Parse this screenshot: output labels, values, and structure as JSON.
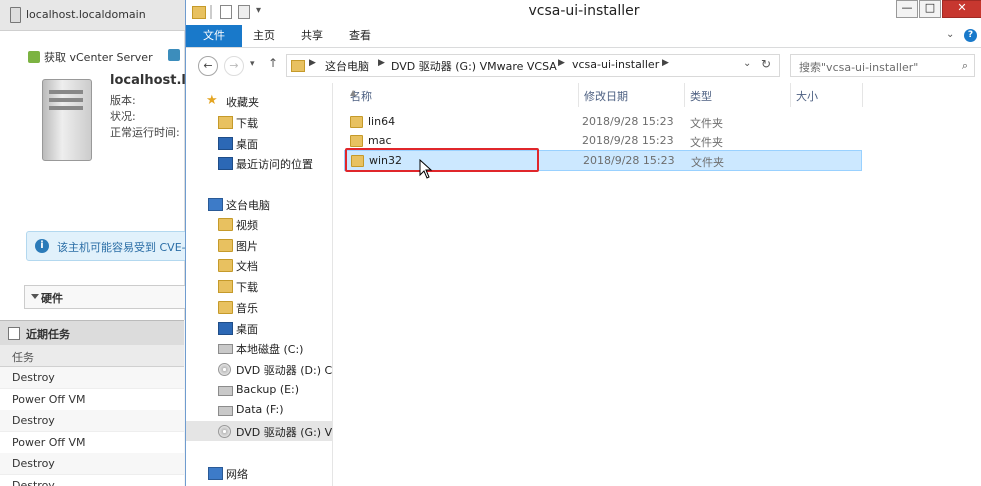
{
  "background_app": {
    "host_tab": "localhost.localdomain",
    "action_label": "获取 vCenter Server",
    "hostname": "localhost.lo",
    "fields": [
      "版本:",
      "状况:",
      "正常运行时间:"
    ],
    "alert_text": "该主机可能容易受到 CVE-",
    "hardware_label": "硬件",
    "recent_tasks_title": "近期任务",
    "tasks_column": "任务",
    "tasks": [
      "Destroy",
      "Power Off VM",
      "Destroy",
      "Power Off VM",
      "Destroy",
      "Destroy"
    ]
  },
  "window": {
    "title": "vcsa-ui-installer",
    "min_glyph": "—",
    "max_glyph": "□",
    "close_glyph": "✕",
    "help_glyph": "?"
  },
  "ribbon": {
    "tabs": [
      "文件",
      "主页",
      "共享",
      "查看"
    ]
  },
  "address": {
    "crumbs": [
      "这台电脑",
      "DVD 驱动器 (G:) VMware VCSA",
      "vcsa-ui-installer"
    ],
    "search_placeholder": "搜索\"vcsa-ui-installer\""
  },
  "nav": {
    "favorites": "收藏夹",
    "favorite_items": [
      "下载",
      "桌面",
      "最近访问的位置"
    ],
    "this_pc": "这台电脑",
    "pc_items": [
      "视频",
      "图片",
      "文档",
      "下载",
      "音乐",
      "桌面",
      "本地磁盘 (C:)",
      "DVD 驱动器 (D:) CD",
      "Backup (E:)",
      "Data (F:)",
      "DVD 驱动器 (G:) VM"
    ],
    "network": "网络"
  },
  "columns": {
    "name": "名称",
    "date": "修改日期",
    "type": "类型",
    "size": "大小"
  },
  "files": [
    {
      "name": "lin64",
      "date": "2018/9/28 15:23",
      "type": "文件夹"
    },
    {
      "name": "mac",
      "date": "2018/9/28 15:23",
      "type": "文件夹"
    },
    {
      "name": "win32",
      "date": "2018/9/28 15:23",
      "type": "文件夹"
    }
  ],
  "colors": {
    "accent": "#1979ca",
    "selection": "#cce8ff",
    "highlight_box": "#e0262b"
  }
}
